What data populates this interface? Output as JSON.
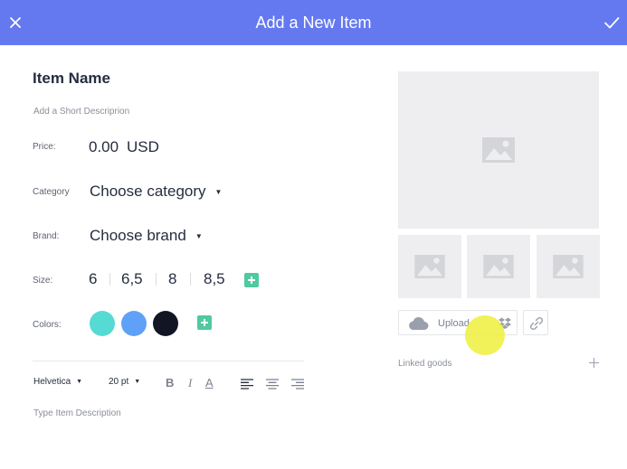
{
  "header": {
    "title": "Add a New Item",
    "close_icon": "close-icon",
    "confirm_icon": "checkmark-icon",
    "background": "#6479f0"
  },
  "item": {
    "name": "Item Name",
    "short_description_placeholder": "Add a Short Descriprion"
  },
  "price": {
    "label": "Price:",
    "value": "0.00",
    "currency": "USD"
  },
  "category": {
    "label": "Category",
    "selected": "Choose category"
  },
  "brand": {
    "label": "Brand:",
    "selected": "Choose brand"
  },
  "size": {
    "label": "Size:",
    "options": [
      "6",
      "6,5",
      "8",
      "8,5"
    ],
    "add_icon": "plus-icon"
  },
  "colors": {
    "label": "Colors:",
    "swatches": [
      "#55dad4",
      "#5ea1f7",
      "#121624"
    ],
    "add_icon": "plus-icon",
    "accent": "#4fc9a0"
  },
  "toolbar": {
    "font": "Helvetica",
    "font_size": "20 pt",
    "bold": "B",
    "italic": "I",
    "text_color": "A",
    "align_icons": [
      "align-left-icon",
      "align-center-icon",
      "align-right-icon"
    ]
  },
  "description": {
    "placeholder": "Type Item Description"
  },
  "media": {
    "upload_label": "Upload",
    "cloud_icon": "cloud-upload-icon",
    "dropbox_icon": "dropbox-icon",
    "link_icon": "link-icon",
    "image_icon": "image-placeholder-icon"
  },
  "linked_goods": {
    "label": "Linked goods",
    "add_icon": "plus-icon"
  }
}
